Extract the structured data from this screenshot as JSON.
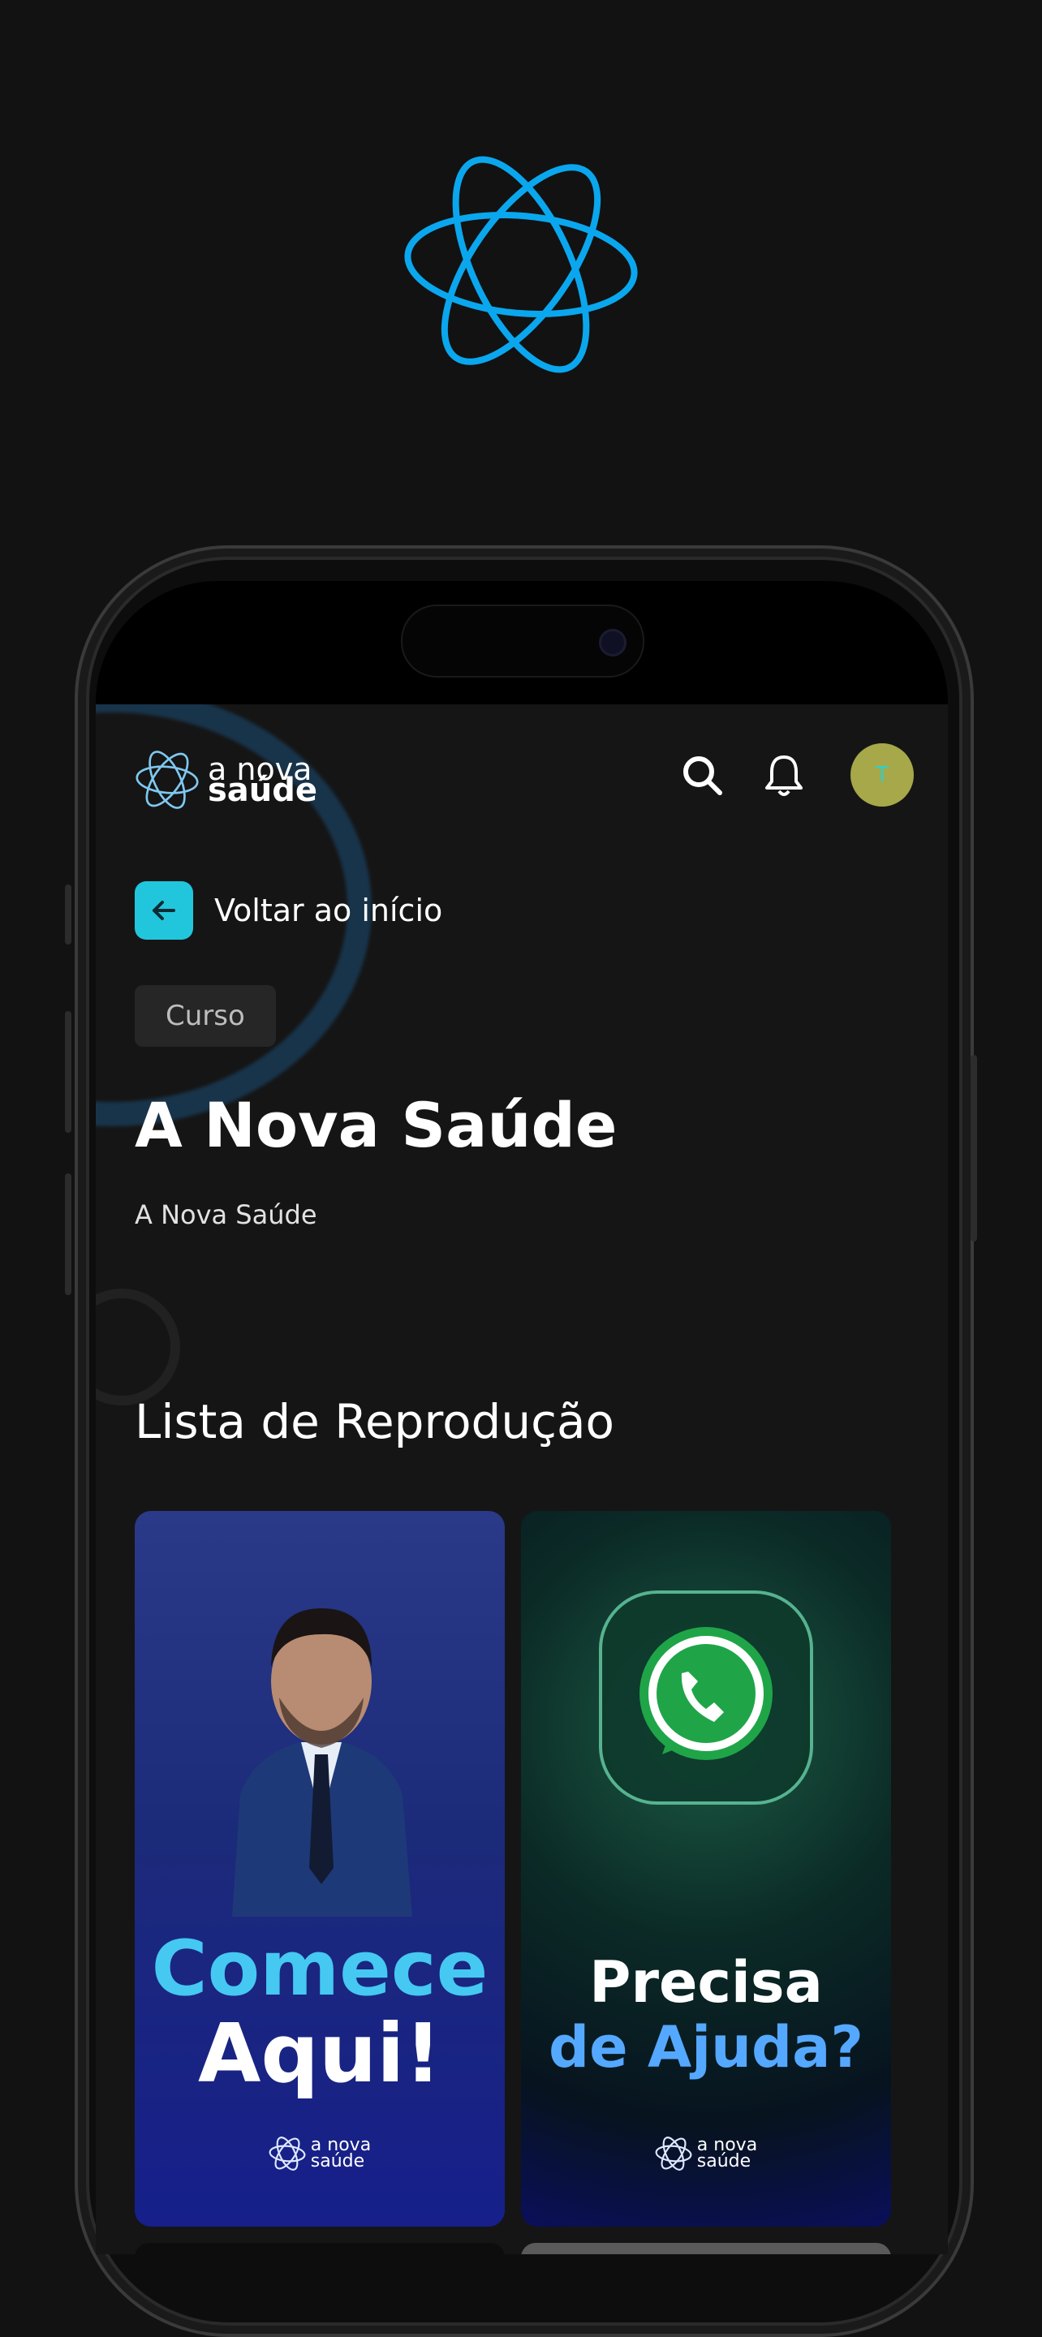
{
  "colors": {
    "accent": "#22c6dc",
    "logo_blue": "#0aa7ee",
    "avatar": "#a6a84a"
  },
  "brand": {
    "line1": "a nova",
    "line2": "saúde"
  },
  "header": {
    "search_icon": "search-icon",
    "bell_icon": "bell-icon",
    "avatar_initial": "T"
  },
  "back": {
    "label": "Voltar ao início",
    "icon": "arrow-left-icon"
  },
  "course": {
    "badge": "Curso",
    "title": "A Nova Saúde",
    "subtitle": "A Nova Saúde"
  },
  "playlist": {
    "heading": "Lista de Reprodução",
    "items": [
      {
        "line1": "Comece",
        "line2": "Aqui!",
        "logo_line1": "a nova",
        "logo_line2": "saúde"
      },
      {
        "line1": "Precisa",
        "line2": "de Ajuda?",
        "logo_line1": "a nova",
        "logo_line2": "saúde"
      }
    ]
  }
}
